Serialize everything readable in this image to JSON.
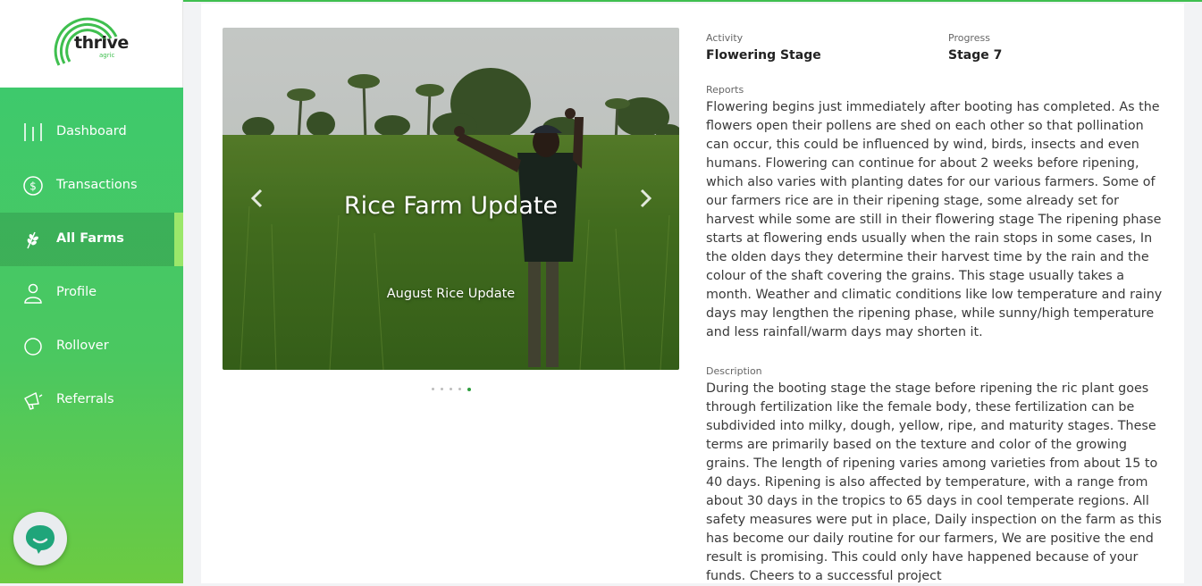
{
  "brand": {
    "name": "thrive",
    "sub": "agric"
  },
  "nav": {
    "items": [
      {
        "label": "Dashboard",
        "icon": "bars-icon"
      },
      {
        "label": "Transactions",
        "icon": "dollar-circle-icon"
      },
      {
        "label": "All Farms",
        "icon": "wheat-icon",
        "active": true
      },
      {
        "label": "Profile",
        "icon": "user-icon"
      },
      {
        "label": "Rollover",
        "icon": "circle-icon"
      },
      {
        "label": "Referrals",
        "icon": "megaphone-icon"
      }
    ]
  },
  "carousel": {
    "title": "Rice Farm Update",
    "subtitle": "August Rice Update",
    "slide_count": 5,
    "active_slide": 5
  },
  "details": {
    "activity_label": "Activity",
    "activity_value": "Flowering Stage",
    "progress_label": "Progress",
    "progress_value": "Stage 7",
    "reports_label": "Reports",
    "reports_text": "Flowering begins just immediately after booting has completed. As the flowers open their pollens are shed on each other so that pollination can occur, this could be influenced by wind, birds, insects and even humans. Flowering can continue for about 2 weeks before ripening, which also varies with planting dates for our various farmers. Some of our farmers rice are in their ripening stage, some already set for harvest while some are still in their flowering stage The ripening phase starts at flowering ends usually when the rain stops in some cases, In the olden days they determine their harvest time by the rain and the colour of the shaft covering the grains. This stage usually takes a month. Weather and climatic conditions like low temperature and rainy days may lengthen the ripening phase, while sunny/high temperature and less rainfall/warm days may shorten it.",
    "description_label": "Description",
    "description_text": "During the booting stage the stage before ripening the ric plant goes through fertilization like the female body, these fertilization can be subdivided into milky, dough, yellow, ripe, and maturity stages. These terms are primarily based on the texture and color of the growing grains. The length of ripening varies among varieties from about 15 to 40 days. Ripening is also affected by temperature, with a range from about 30 days in the tropics to 65 days in cool temperate regions. All safety measures were put in place, Daily inspection on the farm as this has become our daily routine for our farmers, We are positive the end result is promising. This could only have happened because of your funds. Cheers to a successful project"
  },
  "colors": {
    "brand_green": "#3fbf4f",
    "active_bar": "#9be76a",
    "dot_active": "#2e9e3e"
  }
}
